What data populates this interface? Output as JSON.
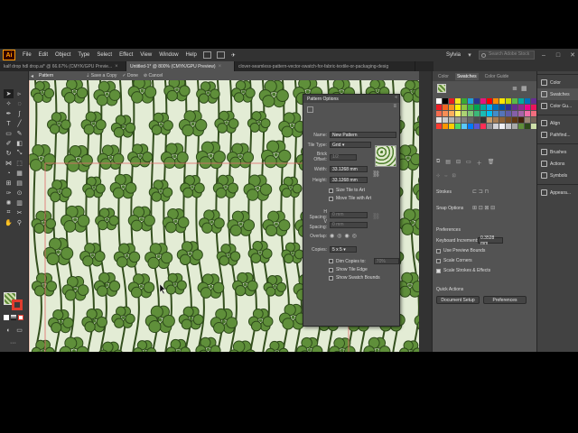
{
  "app": {
    "logo": "Ai"
  },
  "menu": [
    "File",
    "Edit",
    "Object",
    "Type",
    "Select",
    "Effect",
    "View",
    "Window",
    "Help"
  ],
  "menu_right": {
    "workspace": "Sylvia",
    "stock_placeholder": "Search Adobe Stock"
  },
  "tabs": [
    {
      "label": "kalf drop hdl drop.ai* @ 66.67% (CMYK/GPU Previe...",
      "active": false
    },
    {
      "label": "Untitled-1* @ 800% (CMYK/GPU Preview)",
      "active": true
    },
    {
      "label": "clover-seamless-pattern-vector-swatch-for-fabric-textile-or-packaging-desig",
      "active": false
    }
  ],
  "isolation": {
    "label": "Pattern",
    "save": "Save a Copy",
    "done": "Done",
    "cancel": "Cancel"
  },
  "pattern_options": {
    "title": "Pattern Options",
    "name_label": "Name:",
    "name_value": "New Pattern",
    "tile_type_label": "Tile Type:",
    "tile_type_value": "Grid",
    "brick_offset_label": "Brick Offset:",
    "brick_offset_value": "1/2",
    "width_label": "Width:",
    "width_value": "33.1268 mm",
    "height_label": "Height:",
    "height_value": "33.1268 mm",
    "size_tile_label": "Size Tile to Art",
    "move_tile_label": "Move Tile with Art",
    "h_spacing_label": "H Spacing:",
    "h_spacing_value": "0 mm",
    "v_spacing_label": "V Spacing:",
    "v_spacing_value": "0 mm",
    "overlap_label": "Overlap:",
    "copies_label": "Copies:",
    "copies_value": "5 x 5",
    "dim_copies_label": "Dim Copies to:",
    "dim_copies_value": "70%",
    "show_tile_edge_label": "Show Tile Edge",
    "show_swatch_bounds_label": "Show Swatch Bounds"
  },
  "right_panel": {
    "tabs": [
      "Color",
      "Swatches",
      "Color Guide"
    ],
    "active_tab": "Swatches",
    "strokes_label": "Strokes",
    "snap_options_label": "Snap Options",
    "preferences_heading": "Preferences",
    "keyboard_increment_label": "Keyboard Increment:",
    "keyboard_increment_value": "0.3528 mm",
    "use_preview_bounds": "Use Preview Bounds",
    "scale_corners": "Scale Corners",
    "scale_strokes": "Scale Strokes & Effects",
    "quick_actions": "Quick Actions",
    "document_setup": "Document Setup",
    "preferences_btn": "Preferences"
  },
  "dock": [
    "Color",
    "Swatches",
    "Color Gu...",
    "Align",
    "Pathfind...",
    "Brushes",
    "Actions",
    "Symbols",
    "Appeara..."
  ],
  "colors": {
    "clover_fill": "#5f8f3a",
    "clover_stroke": "#2d4a1a",
    "stem": "#34501e",
    "background": "#e3ecd5",
    "tile_edge": "#e06b6b"
  }
}
